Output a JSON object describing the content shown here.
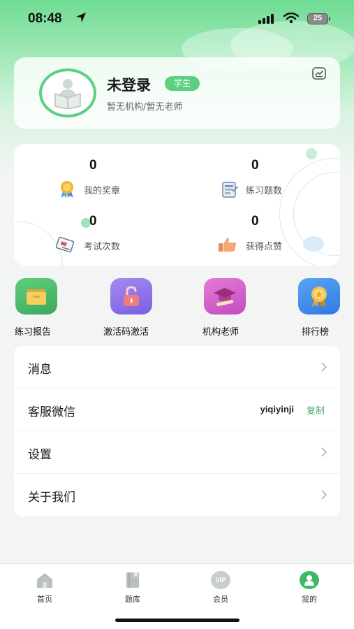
{
  "status_bar": {
    "time": "08:48",
    "battery": "25"
  },
  "profile": {
    "name": "未登录",
    "role": "学生",
    "subtitle": "暂无机构/暂无老师"
  },
  "stats": [
    {
      "value": "0",
      "label": "我的奖章",
      "icon": "medal-icon"
    },
    {
      "value": "0",
      "label": "练习题数",
      "icon": "worksheet-icon"
    },
    {
      "value": "0",
      "label": "考试次数",
      "icon": "exam-paper-icon"
    },
    {
      "value": "0",
      "label": "获得点赞",
      "icon": "thumbs-up-icon"
    }
  ],
  "actions": [
    {
      "label": "练习报告",
      "icon": "report-folder-icon",
      "color": "#4cb86a"
    },
    {
      "label": "激活码激活",
      "icon": "unlock-icon",
      "color": "#8f74e8"
    },
    {
      "label": "机构老师",
      "icon": "graduation-cap-icon",
      "color": "#d45ec9"
    },
    {
      "label": "排行榜",
      "icon": "ranking-badge-icon",
      "color": "#3d8de8"
    }
  ],
  "menu": {
    "messages": "消息",
    "wechat_service": "客服微信",
    "wechat_id": "yiqiyinji",
    "copy": "复制",
    "settings": "设置",
    "about": "关于我们"
  },
  "tabs": [
    {
      "label": "首页",
      "icon": "home-icon"
    },
    {
      "label": "题库",
      "icon": "question-bank-icon"
    },
    {
      "label": "会员",
      "icon": "vip-icon",
      "icon_text": "VIP"
    },
    {
      "label": "我的",
      "icon": "profile-icon"
    }
  ],
  "colors": {
    "accent": "#5ccf83",
    "copy_link": "#4aa86a"
  }
}
